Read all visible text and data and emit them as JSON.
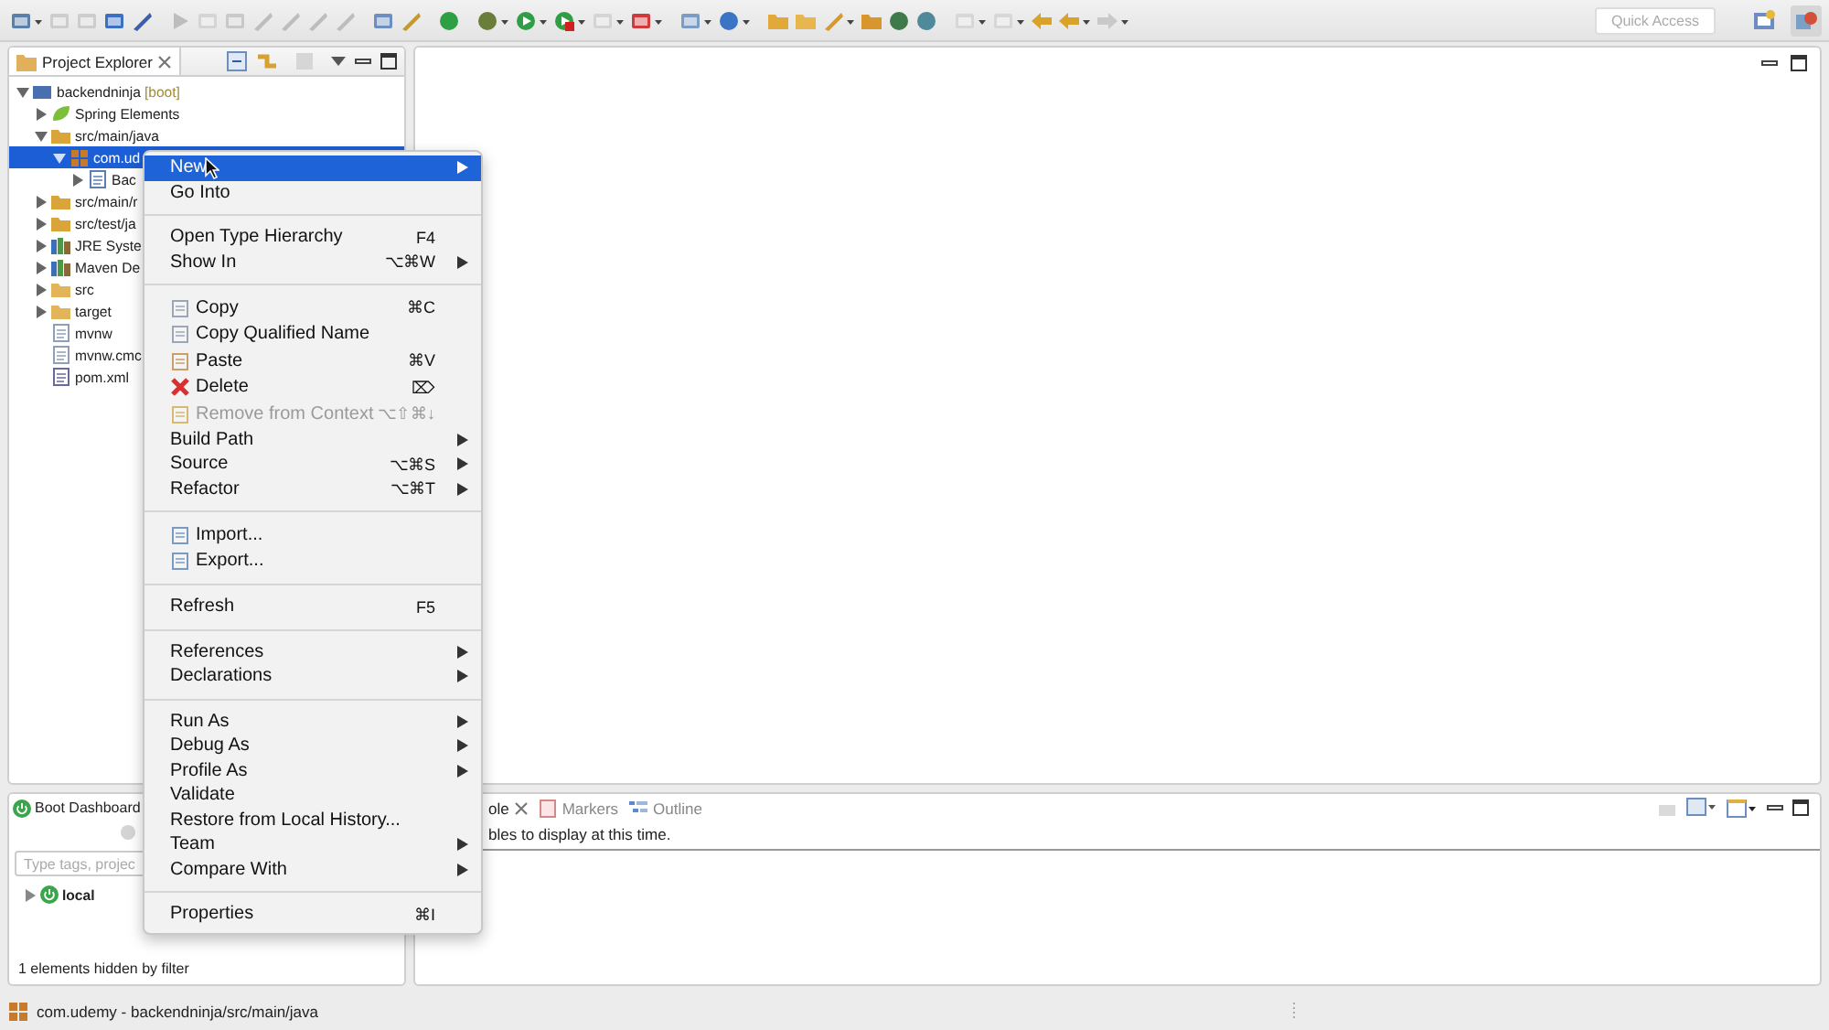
{
  "toolbar": {
    "quick_access": {
      "placeholder": "Quick Access"
    }
  },
  "project_explorer": {
    "tab": {
      "label": "Project Explorer",
      "selected": true
    },
    "tree": [
      {
        "label": "backendninja",
        "decoration": "[boot]",
        "kind": "project",
        "expanded": true,
        "selected": false,
        "children": [
          {
            "label": "Spring Elements",
            "kind": "spring",
            "expanded": false,
            "selected": false
          },
          {
            "label": "src/main/java",
            "kind": "source-folder",
            "expanded": true,
            "selected": false,
            "children": [
              {
                "label": "com.ud",
                "kind": "package",
                "expanded": true,
                "selected": true,
                "children": [
                  {
                    "label": "Bac",
                    "kind": "java-file",
                    "expanded": false,
                    "selected": false
                  }
                ]
              }
            ]
          },
          {
            "label": "src/main/r",
            "kind": "source-folder",
            "expanded": false,
            "selected": false
          },
          {
            "label": "src/test/ja",
            "kind": "source-folder",
            "expanded": false,
            "selected": false
          },
          {
            "label": "JRE Syste",
            "kind": "library",
            "expanded": false,
            "selected": false
          },
          {
            "label": "Maven De",
            "kind": "library",
            "expanded": false,
            "selected": false
          },
          {
            "label": "src",
            "kind": "folder",
            "expanded": false,
            "selected": false
          },
          {
            "label": "target",
            "kind": "folder",
            "expanded": false,
            "selected": false
          },
          {
            "label": "mvnw",
            "kind": "file",
            "selected": false
          },
          {
            "label": "mvnw.cmc",
            "kind": "file",
            "selected": false
          },
          {
            "label": "pom.xml",
            "kind": "xml-file",
            "selected": false
          }
        ]
      }
    ]
  },
  "boot_dashboard": {
    "tab": {
      "label": "Boot Dashboard"
    },
    "search": {
      "placeholder": "Type tags, projec"
    },
    "tree": [
      {
        "label": "local",
        "expanded": false
      }
    ],
    "footer": "1 elements hidden by filter"
  },
  "console": {
    "tabs": [
      {
        "label": "ole",
        "selected": true
      },
      {
        "label": "Markers",
        "selected": false
      },
      {
        "label": "Outline",
        "selected": false
      }
    ],
    "message": "bles to display at this time."
  },
  "context_menu": [
    {
      "kind": "item",
      "label": "New",
      "submenu": true,
      "selected": true,
      "disabled": false
    },
    {
      "kind": "item",
      "label": "Go Into",
      "selected": false,
      "disabled": false
    },
    {
      "kind": "separator"
    },
    {
      "kind": "item",
      "label": "Open Type Hierarchy",
      "shortcut": "F4",
      "selected": false,
      "disabled": false
    },
    {
      "kind": "item",
      "label": "Show In",
      "shortcut": "⌥⌘W",
      "submenu": true,
      "selected": false,
      "disabled": false
    },
    {
      "kind": "separator"
    },
    {
      "kind": "item",
      "label": "Copy",
      "shortcut": "⌘C",
      "selected": false,
      "disabled": false
    },
    {
      "kind": "item",
      "label": "Copy Qualified Name",
      "selected": false,
      "disabled": false
    },
    {
      "kind": "item",
      "label": "Paste",
      "shortcut": "⌘V",
      "selected": false,
      "disabled": false
    },
    {
      "kind": "item",
      "label": "Delete",
      "shortcut": "⌦",
      "selected": false,
      "disabled": false
    },
    {
      "kind": "item",
      "label": "Remove from Context",
      "shortcut": "⌥⇧⌘↓",
      "selected": false,
      "disabled": true
    },
    {
      "kind": "item",
      "label": "Build Path",
      "submenu": true,
      "selected": false,
      "disabled": false
    },
    {
      "kind": "item",
      "label": "Source",
      "shortcut": "⌥⌘S",
      "submenu": true,
      "selected": false,
      "disabled": false
    },
    {
      "kind": "item",
      "label": "Refactor",
      "shortcut": "⌥⌘T",
      "submenu": true,
      "selected": false,
      "disabled": false
    },
    {
      "kind": "separator"
    },
    {
      "kind": "item",
      "label": "Import...",
      "selected": false,
      "disabled": false
    },
    {
      "kind": "item",
      "label": "Export...",
      "selected": false,
      "disabled": false
    },
    {
      "kind": "separator"
    },
    {
      "kind": "item",
      "label": "Refresh",
      "shortcut": "F5",
      "selected": false,
      "disabled": false
    },
    {
      "kind": "separator"
    },
    {
      "kind": "item",
      "label": "References",
      "submenu": true,
      "selected": false,
      "disabled": false
    },
    {
      "kind": "item",
      "label": "Declarations",
      "submenu": true,
      "selected": false,
      "disabled": false
    },
    {
      "kind": "separator"
    },
    {
      "kind": "item",
      "label": "Run As",
      "submenu": true,
      "selected": false,
      "disabled": false
    },
    {
      "kind": "item",
      "label": "Debug As",
      "submenu": true,
      "selected": false,
      "disabled": false
    },
    {
      "kind": "item",
      "label": "Profile As",
      "submenu": true,
      "selected": false,
      "disabled": false
    },
    {
      "kind": "item",
      "label": "Validate",
      "selected": false,
      "disabled": false
    },
    {
      "kind": "item",
      "label": "Restore from Local History...",
      "selected": false,
      "disabled": false
    },
    {
      "kind": "item",
      "label": "Team",
      "submenu": true,
      "selected": false,
      "disabled": false
    },
    {
      "kind": "item",
      "label": "Compare With",
      "submenu": true,
      "selected": false,
      "disabled": false
    },
    {
      "kind": "separator"
    },
    {
      "kind": "item",
      "label": "Properties",
      "shortcut": "⌘I",
      "selected": false,
      "disabled": false
    }
  ],
  "status_bar": {
    "text": "com.udemy - backendninja/src/main/java"
  }
}
